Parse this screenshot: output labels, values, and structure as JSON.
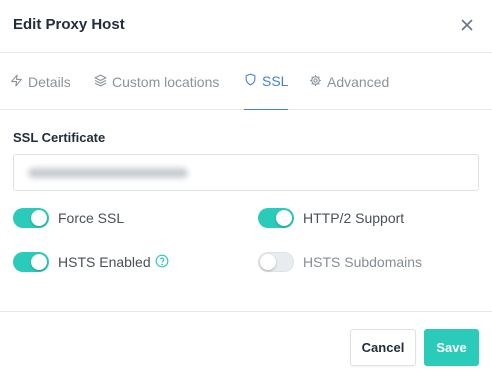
{
  "dialog": {
    "title": "Edit Proxy Host"
  },
  "tabs": [
    {
      "label": "Details",
      "icon": "zap-icon",
      "active": false
    },
    {
      "label": "Custom locations",
      "icon": "layers-icon",
      "active": false
    },
    {
      "label": "SSL",
      "icon": "shield-icon",
      "active": true
    },
    {
      "label": "Advanced",
      "icon": "gear-icon",
      "active": false
    }
  ],
  "ssl": {
    "certificate_label": "SSL Certificate",
    "certificate_value_obscured": true,
    "toggles": [
      {
        "label": "Force SSL",
        "on": true
      },
      {
        "label": "HTTP/2 Support",
        "on": true
      },
      {
        "label": "HSTS Enabled",
        "on": true,
        "help_icon": "help-circle-icon"
      },
      {
        "label": "HSTS Subdomains",
        "on": false,
        "disabled": true
      }
    ]
  },
  "footer": {
    "cancel_label": "Cancel",
    "save_label": "Save"
  },
  "colors": {
    "accent_teal": "#2bcbba",
    "tab_active_blue": "#467fcf",
    "muted_text": "#8a939c"
  }
}
